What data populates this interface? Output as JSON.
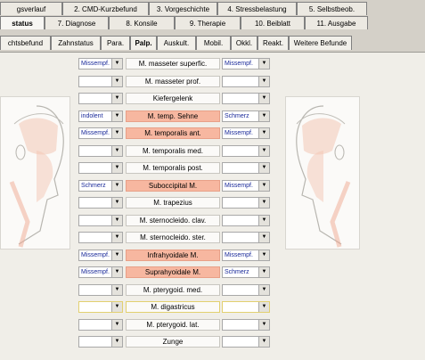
{
  "tabs_row1": [
    "gsverlauf",
    "2. CMD-Kurzbefund",
    "3. Vorgeschichte",
    "4. Stressbelastung",
    "5. Selbstbeob."
  ],
  "tabs_row2": [
    "status",
    "7. Diagnose",
    "8. Konsile",
    "9. Therapie",
    "10. Beiblatt",
    "11. Ausgabe"
  ],
  "tabs_row3": [
    "chtsbefund",
    "Zahnstatus",
    "Para.",
    "Palp.",
    "Auskult.",
    "Mobil.",
    "Okkl.",
    "Reakt.",
    "Weitere Befunde"
  ],
  "active_tab_row2": "status",
  "active_tab_row3": "Palp.",
  "rows": [
    {
      "left": "Missempf.",
      "label": "M. masseter superfic.",
      "right": "Missempf.",
      "highlight": false
    },
    {
      "left": "",
      "label": "M. masseter prof.",
      "right": "",
      "highlight": false
    },
    {
      "left": "",
      "label": "Kiefergelenk",
      "right": "",
      "highlight": false
    },
    {
      "left": "indolent",
      "label": "M. temp. Sehne",
      "right": "Schmerz",
      "highlight": true
    },
    {
      "left": "Missempf.",
      "label": "M. temporalis ant.",
      "right": "Missempf.",
      "highlight": true
    },
    {
      "left": "",
      "label": "M. temporalis med.",
      "right": "",
      "highlight": false
    },
    {
      "left": "",
      "label": "M. temporalis post.",
      "right": "",
      "highlight": false
    },
    {
      "left": "Schmerz",
      "label": "Suboccipital M.",
      "right": "Missempf.",
      "highlight": true
    },
    {
      "left": "",
      "label": "M. trapezius",
      "right": "",
      "highlight": false
    },
    {
      "left": "",
      "label": "M. sternocleido. clav.",
      "right": "",
      "highlight": false
    },
    {
      "left": "",
      "label": "M. sternocleido. ster.",
      "right": "",
      "highlight": false
    },
    {
      "left": "Missempf.",
      "label": "Infrahyoidale M.",
      "right": "Missempf.",
      "highlight": true
    },
    {
      "left": "Missempf.",
      "label": "Suprahyoidale M.",
      "right": "Schmerz",
      "highlight": true
    },
    {
      "left": "",
      "label": "M. pterygoid. med.",
      "right": "",
      "highlight": false
    },
    {
      "left": "",
      "label": "M. digastricus",
      "right": "",
      "highlight": false,
      "yellow": true
    },
    {
      "left": "",
      "label": "M. pterygoid. lat.",
      "right": "",
      "highlight": false
    },
    {
      "left": "",
      "label": "Zunge",
      "right": "",
      "highlight": false
    }
  ],
  "dropdown_arrow": "▼",
  "icons": {
    "left": "face-profile-left-icon",
    "right": "face-profile-right-icon"
  }
}
